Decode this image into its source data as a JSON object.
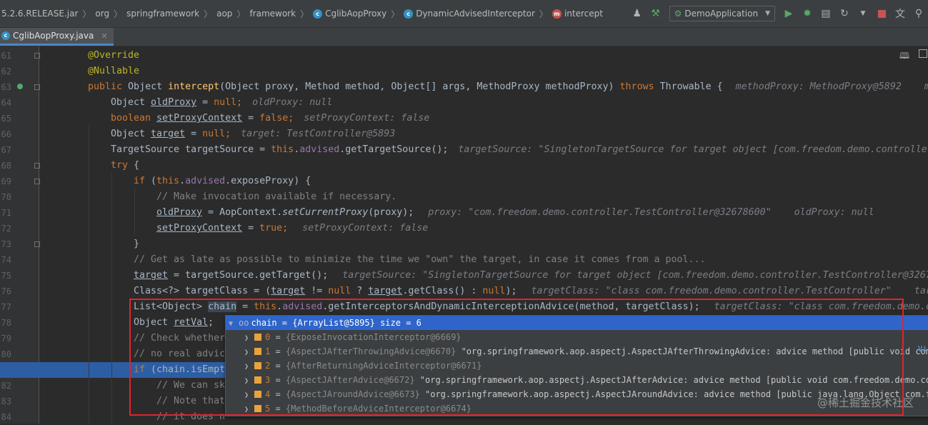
{
  "breadcrumbs": [
    {
      "label": "5.2.6.RELEASE.jar",
      "icon": "none"
    },
    {
      "label": "org",
      "icon": "none"
    },
    {
      "label": "springframework",
      "icon": "none"
    },
    {
      "label": "aop",
      "icon": "none"
    },
    {
      "label": "framework",
      "icon": "none"
    },
    {
      "label": "CglibAopProxy",
      "icon": "class-icon"
    },
    {
      "label": "DynamicAdvisedInterceptor",
      "icon": "class-icon"
    },
    {
      "label": "intercept",
      "icon": "method-icon"
    }
  ],
  "run_config": {
    "label": "DemoApplication"
  },
  "tab": {
    "label": "CglibAopProxy.java"
  },
  "line_numbers": [
    "61",
    "62",
    "63",
    "64",
    "65",
    "66",
    "67",
    "68",
    "69",
    "70",
    "71",
    "72",
    "73",
    "74",
    "75",
    "76",
    "77",
    "78",
    "79",
    "80",
    "81",
    "82",
    "83",
    "84"
  ],
  "code": {
    "l61": "@Override",
    "l62": "@Nullable",
    "l63_a": "public",
    "l63_b": " Object ",
    "l63_c": "intercept",
    "l63_d": "(Object proxy, Method method, Object[] args, MethodProxy methodProxy) ",
    "l63_e": "throws",
    "l63_f": " Throwable {",
    "l63_hint": "methodProxy: MethodProxy@5892    me",
    "l64_a": "Object ",
    "l64_b": "oldProxy",
    "l64_c": " = ",
    "l64_d": "null",
    "l64_e": ";",
    "l64_hint": "oldProxy: null",
    "l65_a": "boolean ",
    "l65_b": "setProxyContext",
    "l65_c": " = ",
    "l65_d": "false",
    "l65_e": ";",
    "l65_hint": "setProxyContext: false",
    "l66_a": "Object ",
    "l66_b": "target",
    "l66_c": " = ",
    "l66_d": "null",
    "l66_e": ";",
    "l66_hint": "target: TestController@5893",
    "l67_a": "TargetSource targetSource = ",
    "l67_b": "this",
    "l67_c": ".",
    "l67_d": "advised",
    "l67_e": ".getTargetSource();",
    "l67_hint": "targetSource: \"SingletonTargetSource for target object [com.freedom.demo.controlle",
    "l68_a": "try",
    "l68_b": " {",
    "l69_a": "if",
    "l69_b": " (",
    "l69_c": "this",
    "l69_d": ".",
    "l69_e": "advised",
    "l69_f": ".exposeProxy) {",
    "l70": "// Make invocation available if necessary.",
    "l71_a": "oldProxy",
    "l71_b": " = AopContext.",
    "l71_c": "setCurrentProxy",
    "l71_d": "(proxy);",
    "l71_hint": "proxy: \"com.freedom.demo.controller.TestController@32678600\"    oldProxy: null",
    "l72_a": "setProxyContext",
    "l72_b": " = ",
    "l72_c": "true",
    "l72_d": ";",
    "l72_hint": "setProxyContext: false",
    "l73": "}",
    "l74": "// Get as late as possible to minimize the time we \"own\" the target, in case it comes from a pool...",
    "l75_a": "target",
    "l75_b": " = targetSource.getTarget();",
    "l75_hint": "targetSource: \"SingletonTargetSource for target object [com.freedom.demo.controller.TestController@3267",
    "l76_a": "Class<?> targetClass = (",
    "l76_b": "target",
    "l76_c": " != ",
    "l76_d": "null",
    "l76_e": " ? ",
    "l76_f": "target",
    "l76_g": ".getClass() : ",
    "l76_h": "null",
    "l76_i": ");",
    "l76_hint": "targetClass: \"class com.freedom.demo.controller.TestController\"    tar",
    "l77_a": "List<Object> ",
    "l77_b": "chain",
    "l77_c": " = ",
    "l77_d": "this",
    "l77_e": ".",
    "l77_f": "advised",
    "l77_g": ".getInterceptorsAndDynamicInterceptionAdvice(method, targetClass);",
    "l77_hint": "targetClass: \"class com.freedom.demo.c",
    "l78_a": "Object ",
    "l78_b": "retVal",
    "l78_c": ";",
    "l79": "// Check whether",
    "l80": "// no real advic",
    "l81_a": "if",
    "l81_b": " (chain.isEmpt",
    "l82": "// We can sk",
    "l83": "// Note that",
    "l84": "// it does n"
  },
  "debug_popup": {
    "header_name": "chain",
    "header_value": " = {ArrayList@5895}  size = 6",
    "items": [
      {
        "index": "0",
        "ref": "{ExposeInvocationInterceptor@6669}",
        "text": ""
      },
      {
        "index": "1",
        "ref": "{AspectJAfterThrowingAdvice@6670}",
        "text": " \"org.springframework.aop.aspectj.AspectJAfterThrowingAdvice: advice method [public void com."
      },
      {
        "index": "2",
        "ref": "{AfterReturningAdviceInterceptor@6671}",
        "text": ""
      },
      {
        "index": "3",
        "ref": "{AspectJAfterAdvice@6672}",
        "text": " \"org.springframework.aop.aspectj.AspectJAfterAdvice: advice method [public void com.freedom.demo.co"
      },
      {
        "index": "4",
        "ref": "{AspectJAroundAdvice@6673}",
        "text": " \"org.springframework.aop.aspectj.AspectJAroundAdvice: advice method [public java.lang.Object com.f"
      },
      {
        "index": "5",
        "ref": "{MethodBeforeAdviceInterceptor@6674}",
        "text": ""
      }
    ],
    "view_link": "Vi"
  },
  "watermark": "@稀土掘金技术社区",
  "colors": {
    "keyword": "#cc7832",
    "annotation": "#bbb529",
    "field": "#9876aa",
    "comment": "#808080",
    "hint": "#7a7e85",
    "exec_line": "#2d5ea3",
    "selection": "#2f65ca",
    "highlight_box": "#e0242b"
  }
}
